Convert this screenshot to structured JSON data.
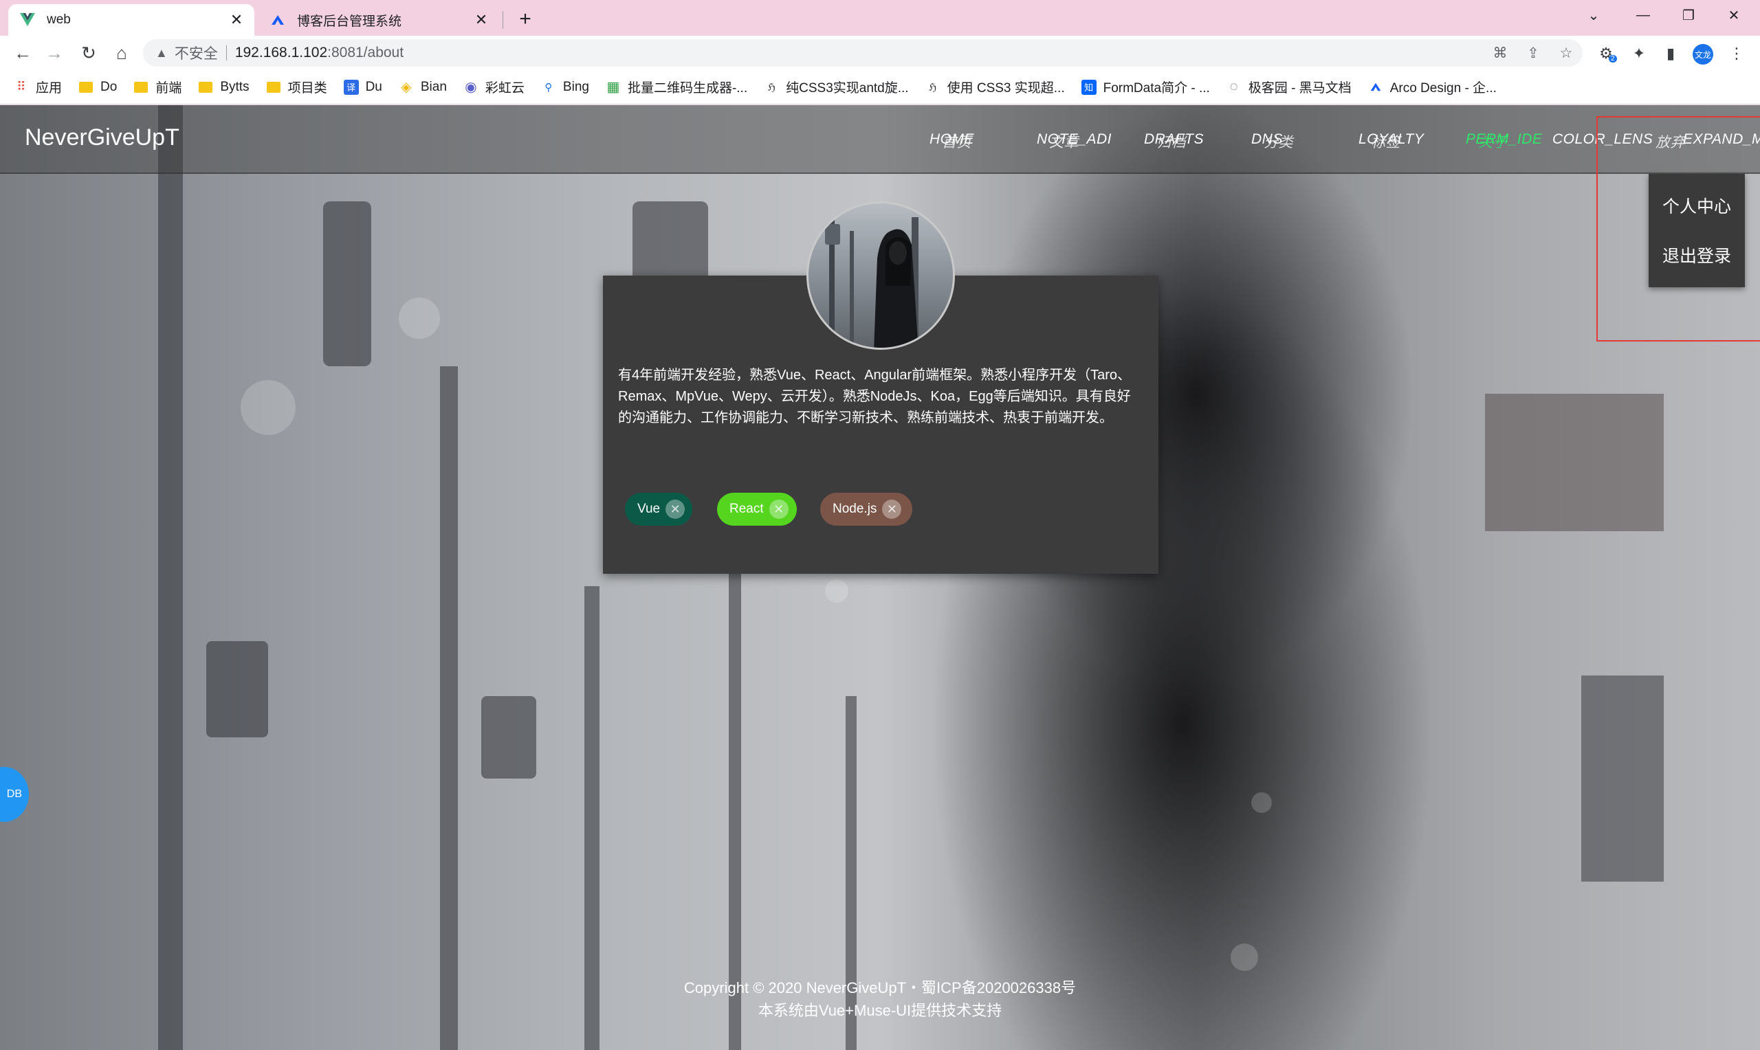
{
  "browser": {
    "tabs": [
      {
        "title": "web",
        "icon": "vue-icon",
        "active": true
      },
      {
        "title": "博客后台管理系统",
        "icon": "arco-icon",
        "active": false
      }
    ],
    "address": {
      "insecure_label": "不安全",
      "host": "192.168.1.102",
      "path": ":8081/about"
    },
    "bookmarks": [
      {
        "label": "应用",
        "icon": "apps-grid-icon"
      },
      {
        "label": "Do",
        "icon": "folder-icon"
      },
      {
        "label": "前端",
        "icon": "folder-icon"
      },
      {
        "label": "Bytts",
        "icon": "folder-icon"
      },
      {
        "label": "项目类",
        "icon": "folder-icon"
      },
      {
        "label": "Du",
        "icon": "translate-icon"
      },
      {
        "label": "Bian",
        "icon": "binance-icon"
      },
      {
        "label": "彩虹云",
        "icon": "rainbow-cloud-icon"
      },
      {
        "label": "Bing",
        "icon": "search-icon"
      },
      {
        "label": "批量二维码生成器-...",
        "icon": "qrcode-icon"
      },
      {
        "label": "纯CSS3实现antd旋...",
        "icon": "spinner-icon"
      },
      {
        "label": "使用 CSS3 实现超...",
        "icon": "spinner-icon"
      },
      {
        "label": "FormData简介 - ...",
        "icon": "zhihu-icon"
      },
      {
        "label": "极客园 - 黑马文档",
        "icon": "globe-icon"
      },
      {
        "label": "Arco Design - 企...",
        "icon": "arco-icon"
      }
    ],
    "avatar_text": "文龙",
    "badge_count": "2"
  },
  "app": {
    "brand": "NeverGiveUpT",
    "nav": [
      {
        "label": "HOME",
        "overlay": "首页",
        "active": false
      },
      {
        "label": "NOTE_ADI",
        "overlay": "文章",
        "active": false
      },
      {
        "label": "DRAFTS",
        "overlay": "归档",
        "active": false
      },
      {
        "label": "DNS",
        "overlay": "分类",
        "active": false
      },
      {
        "label": "LOYALTY",
        "overlay": "标签",
        "active": false
      },
      {
        "label": "PERM_IDE",
        "overlay": "关于",
        "active": true
      },
      {
        "label": "COLOR_LENS",
        "overlay": "",
        "active": false
      },
      {
        "label": "EXPAND_M",
        "overlay": "放弃",
        "active": false
      }
    ],
    "menu": [
      "个人中心",
      "退出登录"
    ]
  },
  "profile": {
    "intro": "有4年前端开发经验，熟悉Vue、React、Angular前端框架。熟悉小程序开发（Taro、Remax、MpVue、Wepy、云开发）。熟悉NodeJs、Koa，Egg等后端知识。具有良好的沟通能力、工作协调能力、不断学习新技术、熟练前端技术、热衷于前端开发。",
    "tags": [
      {
        "label": "Vue",
        "color": "#0b5a47"
      },
      {
        "label": "React",
        "color": "#55d51e"
      },
      {
        "label": "Node.js",
        "color": "#7b5548"
      }
    ]
  },
  "footer": {
    "line1": "Copyright © 2020 NeverGiveUpT・蜀ICP备2020026338号",
    "line2": "本系统由Vue+Muse-UI提供技术支持"
  },
  "side_button": "DB",
  "colors": {
    "active_nav": "#2ee86a",
    "card_bg": "#3c3c3c",
    "menu_bg": "#3a3a3a",
    "highlight_box": "#e53935"
  }
}
